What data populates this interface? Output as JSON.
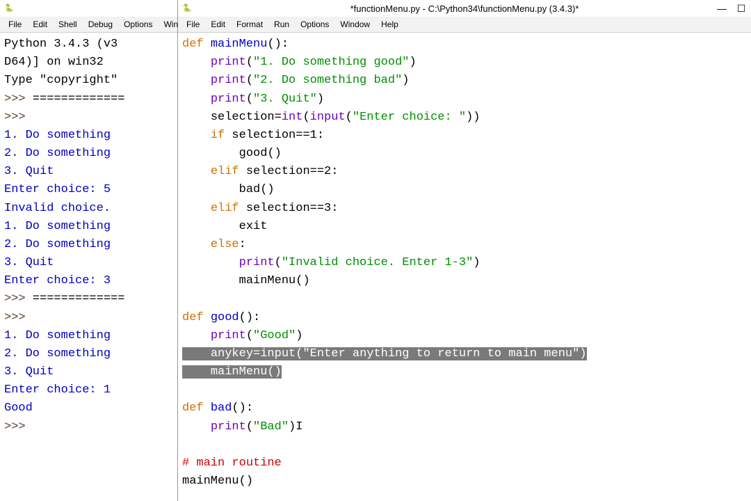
{
  "shell": {
    "icon": "🐍",
    "menu": {
      "file": "File",
      "edit": "Edit",
      "shell": "Shell",
      "debug": "Debug",
      "options": "Options",
      "window": "Window"
    },
    "banner1": "Python 3.4.3 (v3",
    "banner2": "D64)] on win32",
    "banner3": "Type \"copyright\"",
    "prompt": ">>> ",
    "restart": "=============",
    "menu1": "1. Do something",
    "menu2": "2. Do something",
    "menu3": "3. Quit",
    "enter5": "Enter choice: 5",
    "invalid": "Invalid choice.",
    "enter3": "Enter choice: 3",
    "enter1": "Enter choice: 1",
    "good": "Good"
  },
  "editor": {
    "title": "*functionMenu.py - C:\\Python34\\functionMenu.py (3.4.3)*",
    "icon": "🐍",
    "controls": {
      "min": "—",
      "max": "☐"
    },
    "menu": {
      "file": "File",
      "edit": "Edit",
      "format": "Format",
      "run": "Run",
      "options": "Options",
      "window": "Window",
      "help": "Help"
    },
    "code": {
      "def": "def",
      "if": "if",
      "elif": "elif",
      "else": "else",
      "mainMenu": "mainMenu",
      "good": "good",
      "bad": "bad",
      "print": "print",
      "int": "int",
      "input": "input",
      "s_menu1": "\"1. Do something good\"",
      "s_menu2": "\"2. Do something bad\"",
      "s_menu3": "\"3. Quit\"",
      "s_enter": "\"Enter choice: \"",
      "selection": "selection",
      "exit": "exit",
      "s_invalid": "\"Invalid choice. Enter 1-3\"",
      "s_good": "\"Good\"",
      "s_anykey": "\"Enter anything to return to main menu\"",
      "anykey": "anykey",
      "s_bad": "\"Bad\"",
      "comment": "# main routine",
      "cursor": "I"
    }
  }
}
